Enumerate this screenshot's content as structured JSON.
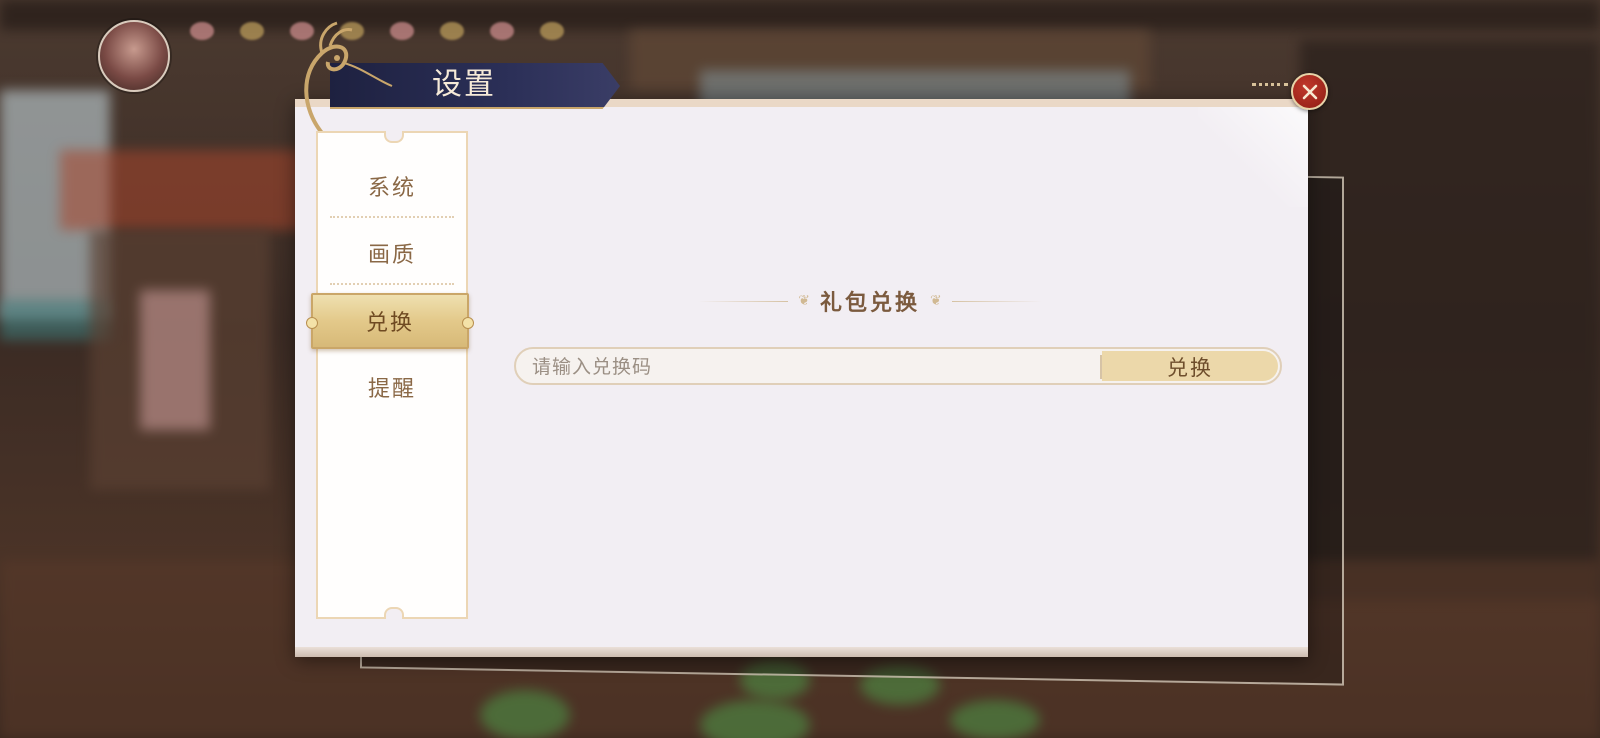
{
  "window": {
    "title": "设置"
  },
  "sidebar": {
    "items": [
      {
        "label": "系统",
        "active": false
      },
      {
        "label": "画质",
        "active": false
      },
      {
        "label": "兑换",
        "active": true
      },
      {
        "label": "提醒",
        "active": false
      }
    ]
  },
  "redeem": {
    "section_title": "礼包兑换",
    "input_placeholder": "请输入兑换码",
    "input_value": "",
    "button_label": "兑换"
  },
  "icons": {
    "close": "close-icon",
    "avatar": "avatar",
    "ornament": "deer-ornament-icon"
  },
  "colors": {
    "title_bar": "#2b2f57",
    "accent_gold": "#e3c98a",
    "close_red": "#c0392b",
    "panel_bg": "#f2eef3",
    "text_brown": "#8a6846"
  }
}
